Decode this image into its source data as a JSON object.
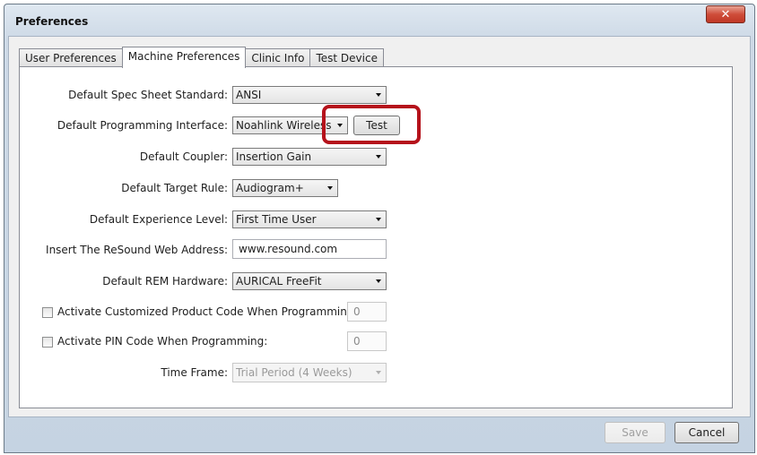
{
  "window": {
    "title": "Preferences",
    "close_symbol": "✕"
  },
  "tabs": [
    {
      "label": "User Preferences"
    },
    {
      "label": "Machine Preferences"
    },
    {
      "label": "Clinic Info"
    },
    {
      "label": "Test Device"
    }
  ],
  "active_tab": "Machine Preferences",
  "form": {
    "spec_sheet": {
      "label": "Default Spec Sheet Standard:",
      "value": "ANSI"
    },
    "programming_interface": {
      "label": "Default Programming Interface:",
      "value": "Noahlink Wireless",
      "test_label": "Test"
    },
    "coupler": {
      "label": "Default Coupler:",
      "value": "Insertion Gain"
    },
    "target_rule": {
      "label": "Default Target Rule:",
      "value": "Audiogram+"
    },
    "experience_level": {
      "label": "Default Experience Level:",
      "value": "First Time User"
    },
    "web_address": {
      "label": "Insert The ReSound Web Address:",
      "value": "www.resound.com"
    },
    "rem_hardware": {
      "label": "Default REM Hardware:",
      "value": "AURICAL FreeFit"
    },
    "custom_product_code": {
      "label": "Activate Customized Product Code When Programming",
      "checked": false,
      "value": "0"
    },
    "pin_code": {
      "label": "Activate PIN Code When Programming:",
      "checked": false,
      "value": "0"
    },
    "time_frame": {
      "label": "Time Frame:",
      "value": "Trial Period (4 Weeks)"
    }
  },
  "footer": {
    "save_label": "Save",
    "cancel_label": "Cancel"
  },
  "colors": {
    "highlight": "#b5121b",
    "close_button": "#cf4d3a",
    "window_frame": "#c5d3e2"
  }
}
